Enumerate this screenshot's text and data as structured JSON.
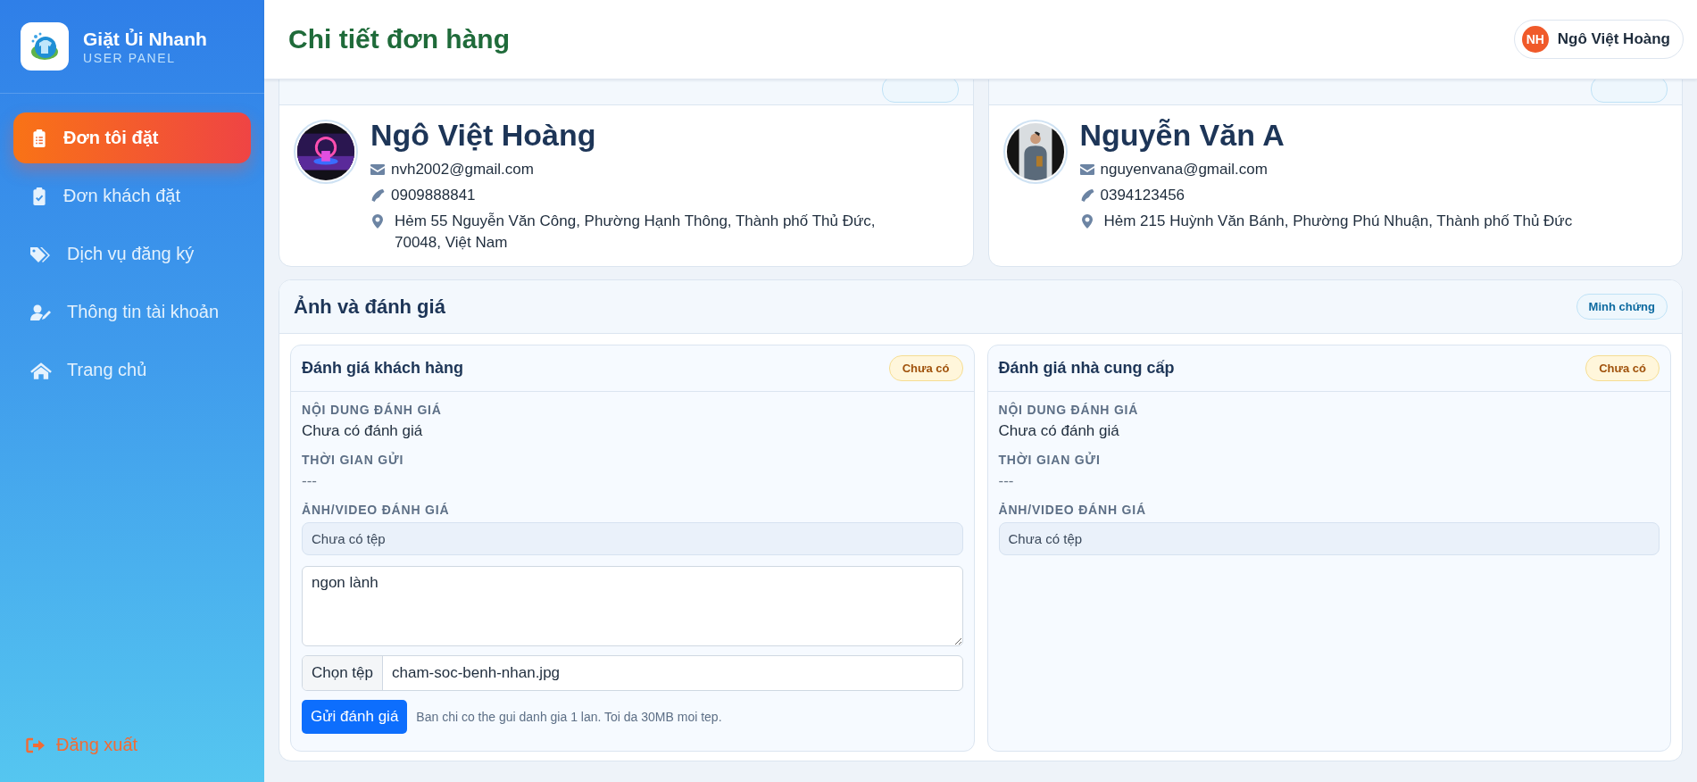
{
  "sidebar": {
    "brand": {
      "name": "Giặt Ủi Nhanh",
      "subtitle": "USER PANEL"
    },
    "items": [
      {
        "label": "Đơn tôi đặt",
        "selected": true
      },
      {
        "label": "Đơn khách đặt",
        "selected": false
      },
      {
        "label": "Dịch vụ đăng ký",
        "selected": false
      },
      {
        "label": "Thông tin tài khoản",
        "selected": false
      },
      {
        "label": "Trang chủ",
        "selected": false
      }
    ],
    "logout": "Đăng xuất"
  },
  "header": {
    "title": "Chi tiết đơn hàng",
    "user": {
      "initials": "NH",
      "name": "Ngô Việt Hoàng"
    }
  },
  "parties": [
    {
      "name": "Ngô Việt Hoàng",
      "email": "nvh2002@gmail.com",
      "phone": "0909888841",
      "address": "Hẻm 55 Nguyễn Văn Công, Phường Hạnh Thông, Thành phố Thủ Đức, 70048, Việt Nam"
    },
    {
      "name": "Nguyễn Văn A",
      "email": "nguyenvana@gmail.com",
      "phone": "0394123456",
      "address": "Hẻm 215 Huỳnh Văn Bánh, Phường Phú Nhuận, Thành phố Thủ Đức"
    }
  ],
  "reviews": {
    "title": "Ảnh và đánh giá",
    "badge": "Minh chứng",
    "panels": [
      {
        "title": "Đánh giá khách hàng",
        "status": "Chưa có",
        "content_label": "NỘI DUNG ĐÁNH GIÁ",
        "content": "Chưa có đánh giá",
        "time_label": "THỜI GIAN GỬI",
        "time": "---",
        "media_label": "ẢNH/VIDEO ĐÁNH GIÁ",
        "media": "Chưa có tệp",
        "form": {
          "comment": "ngon lành",
          "file_button": "Chọn tệp",
          "file_name": "cham-soc-benh-nhan.jpg",
          "submit": "Gửi đánh giá",
          "hint": "Ban chi co the gui danh gia 1 lan. Toi da 30MB moi tep."
        }
      },
      {
        "title": "Đánh giá nhà cung cấp",
        "status": "Chưa có",
        "content_label": "NỘI DUNG ĐÁNH GIÁ",
        "content": "Chưa có đánh giá",
        "time_label": "THỜI GIAN GỬI",
        "time": "---",
        "media_label": "ẢNH/VIDEO ĐÁNH GIÁ",
        "media": "Chưa có tệp"
      }
    ]
  }
}
